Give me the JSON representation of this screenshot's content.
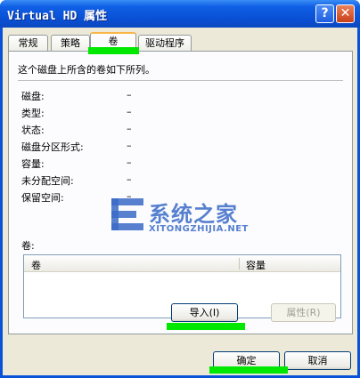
{
  "window": {
    "title": "Virtual HD 属性",
    "help_label": "?",
    "close_label": "✕"
  },
  "tabs": [
    {
      "label": "常规"
    },
    {
      "label": "策略"
    },
    {
      "label": "卷",
      "active": true
    },
    {
      "label": "驱动程序"
    }
  ],
  "panel": {
    "description": "这个磁盘上所含的卷如下所列。",
    "properties": [
      {
        "label": "磁盘:",
        "value": "–"
      },
      {
        "label": "类型:",
        "value": "–"
      },
      {
        "label": "状态:",
        "value": "–"
      },
      {
        "label": "磁盘分区形式:",
        "value": "–"
      },
      {
        "label": "容量:",
        "value": "–"
      },
      {
        "label": "未分配空间:",
        "value": "–"
      },
      {
        "label": "保留空间:",
        "value": "–"
      }
    ],
    "volumes_label": "卷:",
    "columns": [
      "卷",
      "容量"
    ],
    "import_label": "导入(I)",
    "properties_label": "属性(R)"
  },
  "footer": {
    "ok_label": "确定",
    "cancel_label": "取消"
  },
  "watermark": {
    "cn": "系统之家",
    "en": "XITONGZHIJIA.NET"
  },
  "colors": {
    "highlight": "#00e800",
    "titlebar": "#0a53d8"
  }
}
